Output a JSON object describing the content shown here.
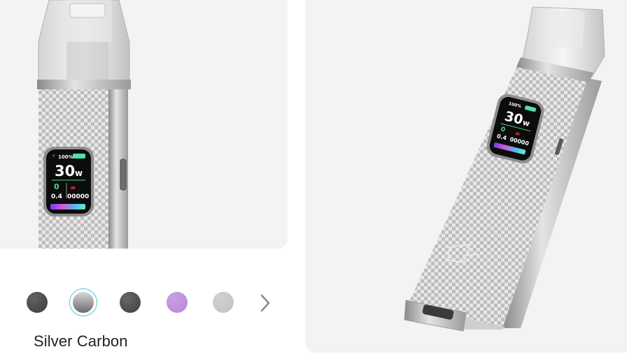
{
  "product_left": {
    "battery_text": "100%",
    "watt_value": "30",
    "watt_unit": "w",
    "resistance": "0.4",
    "puff_count": "00000"
  },
  "product_right": {
    "battery_text": "100%",
    "watt_value": "30",
    "watt_unit": "w",
    "resistance": "0.4",
    "puff_count": "00000"
  },
  "swatches": [
    {
      "name": "dark-gray",
      "color": "#3b3b3b",
      "selected": false
    },
    {
      "name": "silver-carbon",
      "color": "#8c8c8c",
      "selected": true
    },
    {
      "name": "black",
      "color": "#404040",
      "selected": false
    },
    {
      "name": "purple",
      "color": "#b987d9",
      "selected": false
    },
    {
      "name": "silver",
      "color": "#c4c4c4",
      "selected": false
    }
  ],
  "selected_color_name": "Silver Carbon",
  "next_icon": "chevron-right-icon",
  "accent_color": "#4fc6d6"
}
